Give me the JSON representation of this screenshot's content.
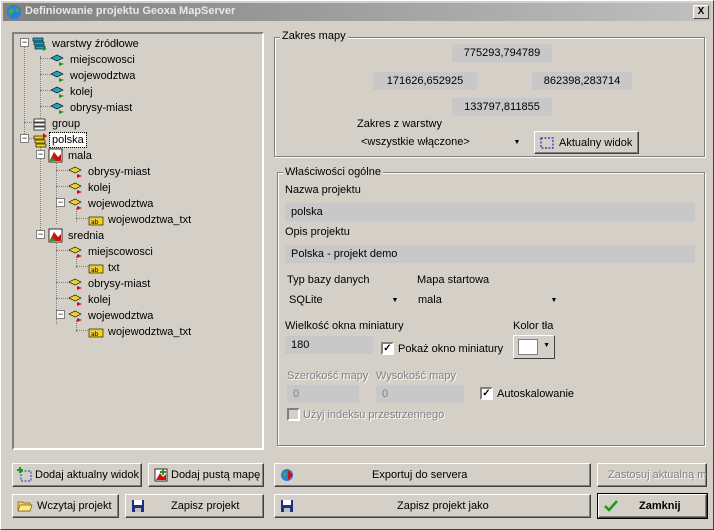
{
  "window": {
    "title": "Definiowanie projektu Geoxa MapServer",
    "close_label": "X"
  },
  "tree": {
    "items": [
      {
        "label": "warstwy źródłowe",
        "icon": "source-layers-icon"
      },
      {
        "label": "miejscowosci",
        "icon": "layer-icon"
      },
      {
        "label": "wojewodztwa",
        "icon": "layer-icon"
      },
      {
        "label": "kolej",
        "icon": "layer-icon"
      },
      {
        "label": "obrysy-miast",
        "icon": "layer-icon"
      },
      {
        "label": "group",
        "icon": "group-icon"
      },
      {
        "label": "polska",
        "icon": "project-icon"
      },
      {
        "label": "mala",
        "icon": "map-icon"
      },
      {
        "label": "obrysy-miast",
        "icon": "layer-red-icon"
      },
      {
        "label": "kolej",
        "icon": "layer-red-icon"
      },
      {
        "label": "wojewodztwa",
        "icon": "layer-red-icon"
      },
      {
        "label": "wojewodztwa_txt",
        "icon": "text-layer-icon"
      },
      {
        "label": "srednia",
        "icon": "map-icon"
      },
      {
        "label": "miejscowosci",
        "icon": "layer-red-icon"
      },
      {
        "label": "txt",
        "icon": "text-layer-icon"
      },
      {
        "label": "obrysy-miast",
        "icon": "layer-red-icon"
      },
      {
        "label": "kolej",
        "icon": "layer-red-icon"
      },
      {
        "label": "wojewodztwa",
        "icon": "layer-red-icon"
      },
      {
        "label": "wojewodztwa_txt",
        "icon": "text-layer-icon"
      }
    ]
  },
  "extent": {
    "group_title": "Zakres mapy",
    "top": "775293,794789",
    "left": "171626,652925",
    "right": "862398,283714",
    "bottom": "133797,811855",
    "from_layer_label": "Zakres z warstwy",
    "from_layer_value": "<wszystkie włączone>",
    "current_view_label": "Aktualny widok"
  },
  "general": {
    "group_title": "Właściwości ogólne",
    "name_label": "Nazwa projektu",
    "name_value": "polska",
    "desc_label": "Opis projektu",
    "desc_value": "Polska - projekt demo",
    "db_type_label": "Typ bazy danych",
    "db_type_value": "SQLite",
    "start_map_label": "Mapa startowa",
    "start_map_value": "mala",
    "mini_size_label": "Wielkość okna miniatury",
    "mini_size_value": "180",
    "show_mini_label": "Pokaż okno miniatury",
    "bg_color_label": "Kolor tła",
    "bg_color": "#ffffff",
    "width_label": "Szerokość mapy",
    "width_value": "0",
    "height_label": "Wysokość mapy",
    "height_value": "0",
    "autoscale_label": "Autoskalowanie",
    "spatial_index_label": "Użyj indeksu przestrzennego"
  },
  "buttons": {
    "add_current_view": "Dodaj aktualny widok",
    "add_empty_map": "Dodaj pustą mapę",
    "export_server": "Exportuj do servera",
    "apply_current_map": "Zastosuj aktualną mapę",
    "load_project": "Wczytaj projekt",
    "save_project": "Zapisz projekt",
    "save_project_as": "Zapisz projekt jako",
    "close": "Zamknij"
  },
  "colors": {
    "face": "#d4d0c8",
    "field": "#c8c8c8",
    "layer_cyan": "#20a0c0",
    "layer_yellow": "#f0d020",
    "layer_red": "#d01010"
  }
}
